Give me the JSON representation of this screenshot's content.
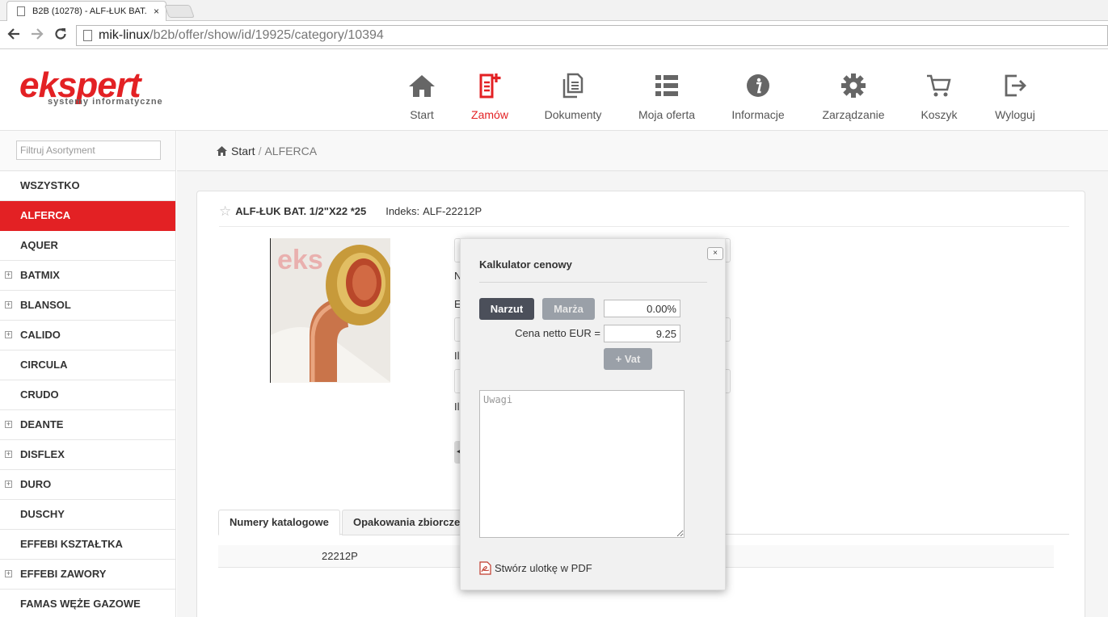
{
  "browser": {
    "tab_title": "B2B (10278) - ALF-ŁUK BAT.",
    "tab_close": "×",
    "url_host": "mik-linux",
    "url_path": "/b2b/offer/show/id/19925/category/10394"
  },
  "header": {
    "logo_text": "ekspert",
    "logo_subtitle": "systemy informatyczne",
    "nav": [
      {
        "label": "Start",
        "icon": "home-icon"
      },
      {
        "label": "Zamów",
        "icon": "order-icon",
        "active": true
      },
      {
        "label": "Dokumenty",
        "icon": "documents-icon"
      },
      {
        "label": "Moja oferta",
        "icon": "list-icon"
      },
      {
        "label": "Informacje",
        "icon": "info-icon"
      },
      {
        "label": "Zarządzanie",
        "icon": "gear-icon"
      },
      {
        "label": "Koszyk",
        "icon": "cart-icon"
      },
      {
        "label": "Wyloguj",
        "icon": "logout-icon"
      }
    ],
    "accent_color": "#e32124"
  },
  "sidebar": {
    "filter_placeholder": "Filtruj Asortyment",
    "items": [
      {
        "label": "WSZYSTKO",
        "expandable": false
      },
      {
        "label": "ALFERCA",
        "expandable": false,
        "active": true
      },
      {
        "label": "AQUER",
        "expandable": false
      },
      {
        "label": "BATMIX",
        "expandable": true
      },
      {
        "label": "BLANSOL",
        "expandable": true
      },
      {
        "label": "CALIDO",
        "expandable": true
      },
      {
        "label": "CIRCULA",
        "expandable": false
      },
      {
        "label": "CRUDO",
        "expandable": false
      },
      {
        "label": "DEANTE",
        "expandable": true
      },
      {
        "label": "DISFLEX",
        "expandable": true
      },
      {
        "label": "DURO",
        "expandable": true
      },
      {
        "label": "DUSCHY",
        "expandable": false
      },
      {
        "label": "EFFEBI KSZTAŁTKA",
        "expandable": false
      },
      {
        "label": "EFFEBI ZAWORY",
        "expandable": true
      },
      {
        "label": "FAMAS WĘŻE GAZOWE",
        "expandable": false
      }
    ],
    "expander_symbol": "+"
  },
  "breadcrumb": {
    "start": "Start",
    "separator": "/",
    "current": "ALFERCA"
  },
  "product": {
    "star": "☆",
    "name": "ALF-ŁUK BAT. 1/2\"X22 *25",
    "index_label": "Indeks:",
    "index": "ALF-22212P",
    "partial_labels": [
      "N",
      "E",
      "Il",
      "Il"
    ],
    "partial_arrow": "◄"
  },
  "tabs": {
    "items": [
      "Numery katalogowe",
      "Opakowania zbiorcze"
    ],
    "row_value": "22212P"
  },
  "calculator": {
    "title": "Kalkulator cenowy",
    "close": "×",
    "narzut_label": "Narzut",
    "marza_label": "Marża",
    "percent_value": "0.00%",
    "cena_label": "Cena netto EUR =",
    "cena_value": "9.25",
    "vat_label": "+ Vat",
    "notes_placeholder": "Uwagi",
    "pdf_label": "Stwórz ulotkę w PDF"
  }
}
